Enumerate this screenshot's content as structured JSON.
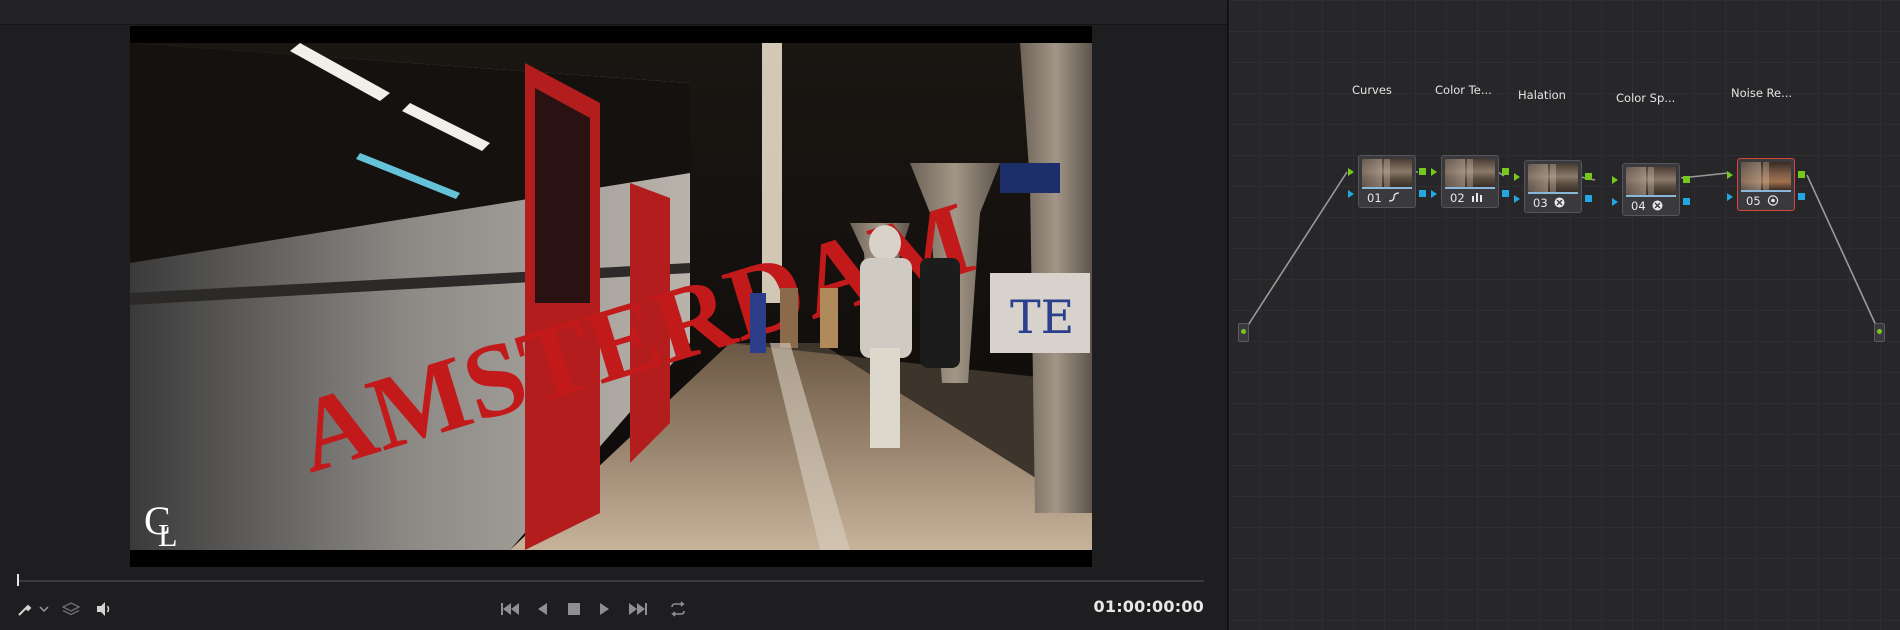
{
  "viewer": {
    "timecode": "01:00:00:00",
    "overlay_text": "AMSTERDAM",
    "logo_text": "CL"
  },
  "node_editor": {
    "nodes": [
      {
        "title": "Curves",
        "number": "01",
        "icon": "curve-icon"
      },
      {
        "title": "Color Te...",
        "number": "02",
        "icon": "bars-icon"
      },
      {
        "title": "Halation",
        "number": "03",
        "icon": "fx-icon"
      },
      {
        "title": "Color Sp...",
        "number": "04",
        "icon": "fx-icon"
      },
      {
        "title": "Noise Re...",
        "number": "05",
        "icon": "noise-icon",
        "selected": true
      }
    ]
  },
  "colors": {
    "primary_port": "#76c81c",
    "secondary_port": "#22a7e0",
    "selected_border": "#d8453b"
  }
}
